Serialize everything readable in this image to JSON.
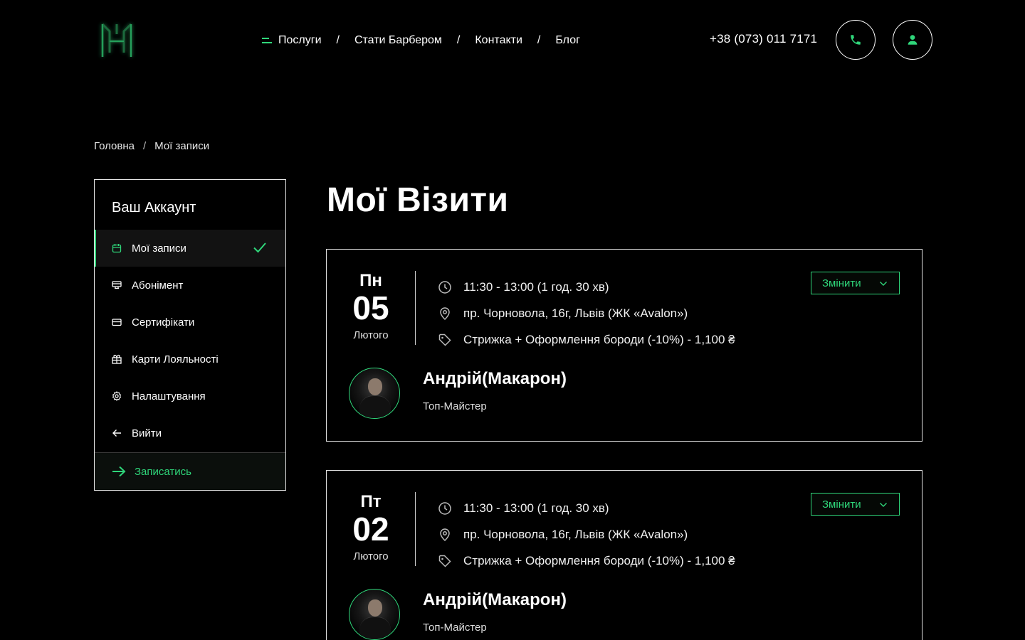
{
  "header": {
    "nav": {
      "services": "Послуги",
      "become_barber": "Стати Барбером",
      "contacts": "Контакти",
      "blog": "Блог",
      "separator": "/"
    },
    "phone": "+38 (073) 011 7171",
    "icons": {
      "logo": "m-logo-icon",
      "menu": "menu-icon",
      "call": "phone-icon",
      "user": "user-icon"
    }
  },
  "breadcrumb": {
    "home": "Головна",
    "separator": "/",
    "current": "Мої записи"
  },
  "sidebar": {
    "title": "Ваш Аккаунт",
    "items": [
      {
        "label": "Мої записи",
        "icon": "calendar-icon",
        "active": true
      },
      {
        "label": "Абонімент",
        "icon": "card-stack-icon"
      },
      {
        "label": "Сертифікати",
        "icon": "credit-card-icon"
      },
      {
        "label": "Карти Лояльності",
        "icon": "gift-icon"
      },
      {
        "label": "Налаштування",
        "icon": "gear-icon"
      },
      {
        "label": "Вийти",
        "icon": "arrow-left-icon"
      }
    ],
    "cta": "Записатись"
  },
  "page_title": "Мої Візити",
  "visits": [
    {
      "dow": "Пн",
      "day": "05",
      "month": "Лютого",
      "time": "11:30 - 13:00 (1 год. 30 хв)",
      "address": "пр. Чорновола, 16г, Львів (ЖК «Avalon»)",
      "service": "Стрижка + Оформлення бороди (-10%) - 1,100 ₴",
      "change_label": "Змінити",
      "master_name": "Андрій(Макарон)",
      "master_role": "Топ-Майстер"
    },
    {
      "dow": "Пт",
      "day": "02",
      "month": "Лютого",
      "time": "11:30 - 13:00 (1 год. 30 хв)",
      "address": "пр. Чорновола, 16г, Львів (ЖК «Avalon»)",
      "service": "Стрижка + Оформлення бороди (-10%) - 1,100 ₴",
      "change_label": "Змінити",
      "master_name": "Андрій(Макарон)",
      "master_role": "Топ-Майстер"
    }
  ],
  "colors": {
    "accent": "#2fd67a",
    "background": "#000000",
    "text": "#ffffff"
  }
}
